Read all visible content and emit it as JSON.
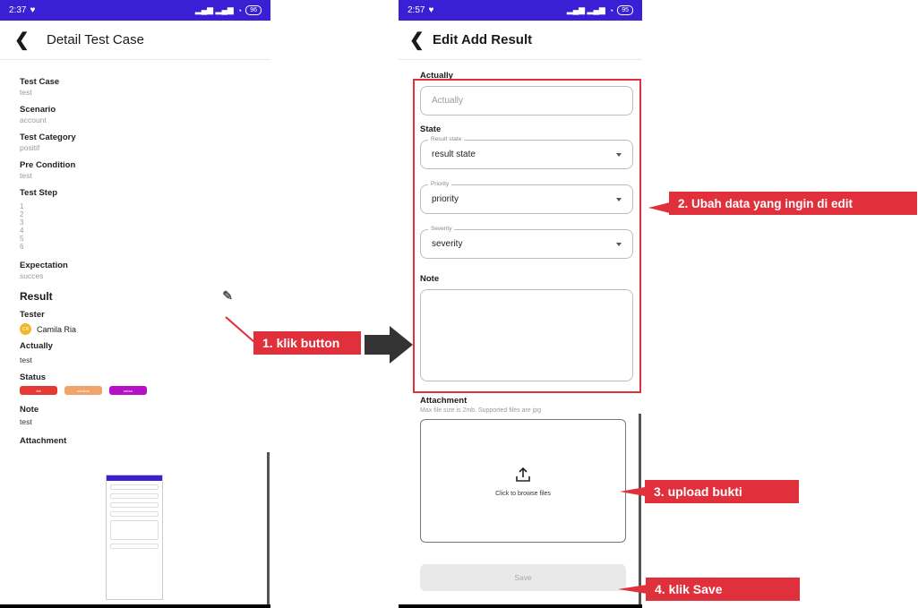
{
  "left_screen": {
    "status": {
      "time": "2:37",
      "battery": "96"
    },
    "title": "Detail Test Case",
    "fields": [
      {
        "label": "Test Case",
        "value": "test"
      },
      {
        "label": "Scenario",
        "value": "account"
      },
      {
        "label": "Test Category",
        "value": "positif"
      },
      {
        "label": "Pre Condition",
        "value": "test"
      }
    ],
    "test_step": {
      "label": "Test Step",
      "steps": [
        "1",
        "2",
        "3",
        "4",
        "5",
        "6"
      ]
    },
    "expectation": {
      "label": "Expectation",
      "value": "succes"
    },
    "result": {
      "title": "Result",
      "tester_label": "Tester",
      "tester_initials": "CR",
      "tester_name": "Camila Ria",
      "actually_label": "Actually",
      "actually_value": "test",
      "status_label": "Status",
      "status_pills": [
        {
          "text": "fail",
          "color": "#e53935"
        },
        {
          "text": "medium",
          "color": "#f0a36b"
        },
        {
          "text": "minor",
          "color": "#b510c8"
        }
      ],
      "note_label": "Note",
      "note_value": "test",
      "attachment_label": "Attachment"
    }
  },
  "right_screen": {
    "status": {
      "time": "2:57",
      "battery": "95"
    },
    "title": "Edit Add Result",
    "actually_label": "Actually",
    "actually_placeholder": "Actually",
    "state_label": "State",
    "selects": [
      {
        "legend": "Result state",
        "value": "result state"
      },
      {
        "legend": "Priority",
        "value": "priority"
      },
      {
        "legend": "Severity",
        "value": "severity"
      }
    ],
    "note_label": "Note",
    "attachment_label": "Attachment",
    "attachment_hint": "Max file size is 2mb. Supported files are jpg",
    "upload_text": "Click to browse files",
    "save_label": "Save"
  },
  "annotations": {
    "step1": "1. klik button",
    "step2": "2. Ubah data yang ingin di edit",
    "step3": "3. upload bukti",
    "step4": "4. klik Save"
  },
  "colors": {
    "status_bar": "#3a1fd4",
    "callout": "#e0303b"
  }
}
